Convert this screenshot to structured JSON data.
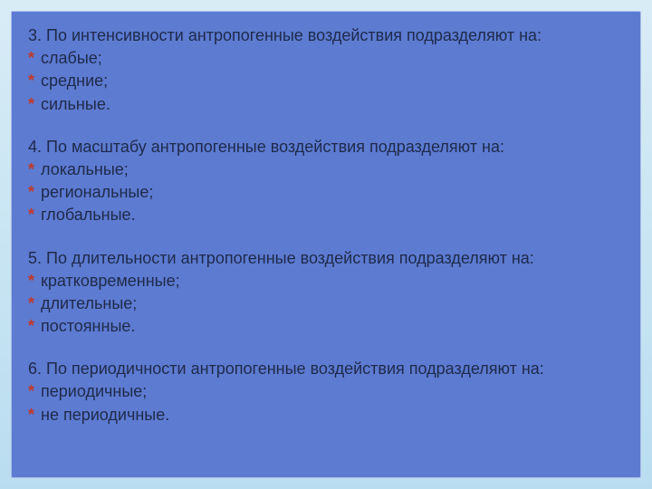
{
  "sections": [
    {
      "heading": "3. По интенсивности антропогенные воздействия подразделяют на:",
      "items": [
        "слабые;",
        "средние;",
        "сильные."
      ]
    },
    {
      "heading": "4. По масштабу антропогенные воздействия подразделяют на:",
      "items": [
        "локальные;",
        "региональные;",
        "глобальные."
      ]
    },
    {
      "heading": "5. По длительности антропогенные воздействия подразделяют на:",
      "items": [
        "кратковременные;",
        "длительные;",
        "постоянные."
      ]
    },
    {
      "heading": "6. По периодичности антропогенные воздействия подразделяют на:",
      "items": [
        "периодичные;",
        "не периодичные."
      ]
    }
  ],
  "bullet": "*"
}
